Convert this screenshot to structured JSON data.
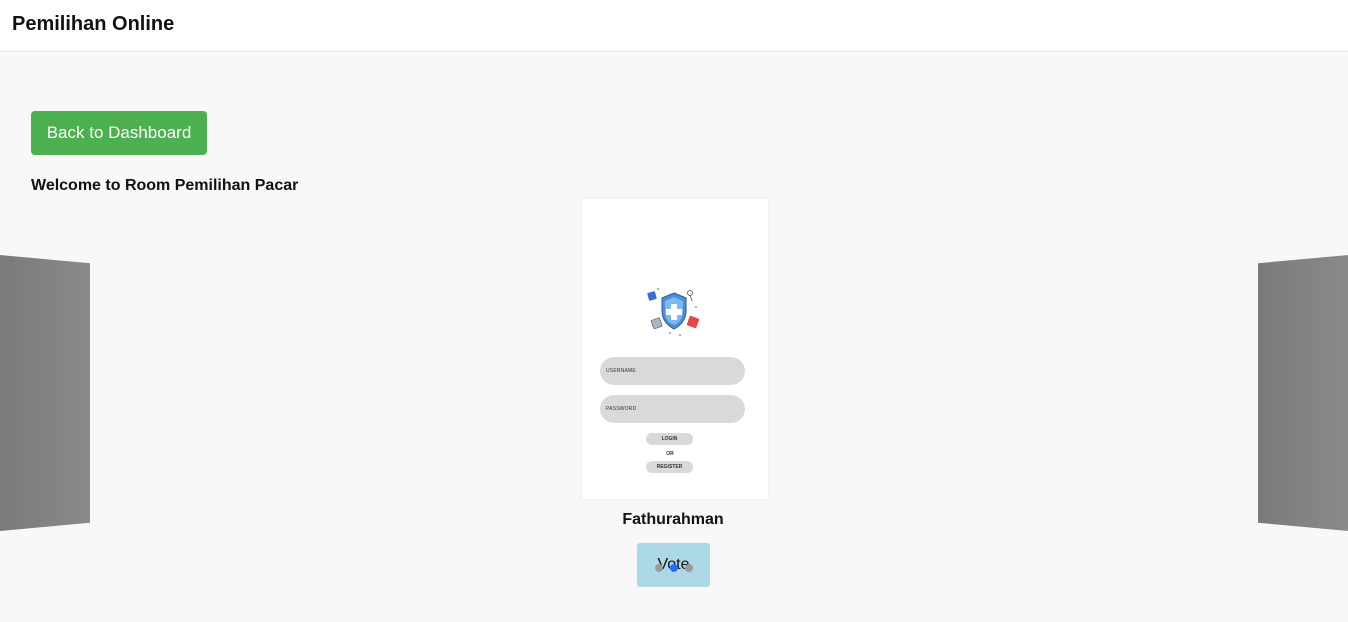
{
  "header": {
    "title": "Pemilihan Online"
  },
  "actions": {
    "back_label": "Back to Dashboard"
  },
  "room": {
    "title": "Welcome to Room Pemilihan Pacar"
  },
  "candidate": {
    "name": "Fathurahman",
    "vote_label": "Vote",
    "photo": {
      "username_label": "USERNAME",
      "password_label": "PASSWORD",
      "login_label": "LOGIN",
      "or_label": "OR",
      "register_label": "REGISTER"
    }
  },
  "carousel": {
    "dot_count": 3,
    "active_index": 1
  },
  "colors": {
    "accent_green": "#4caf50",
    "vote_blue": "#add8e6",
    "dot_active": "#1e6fff"
  }
}
